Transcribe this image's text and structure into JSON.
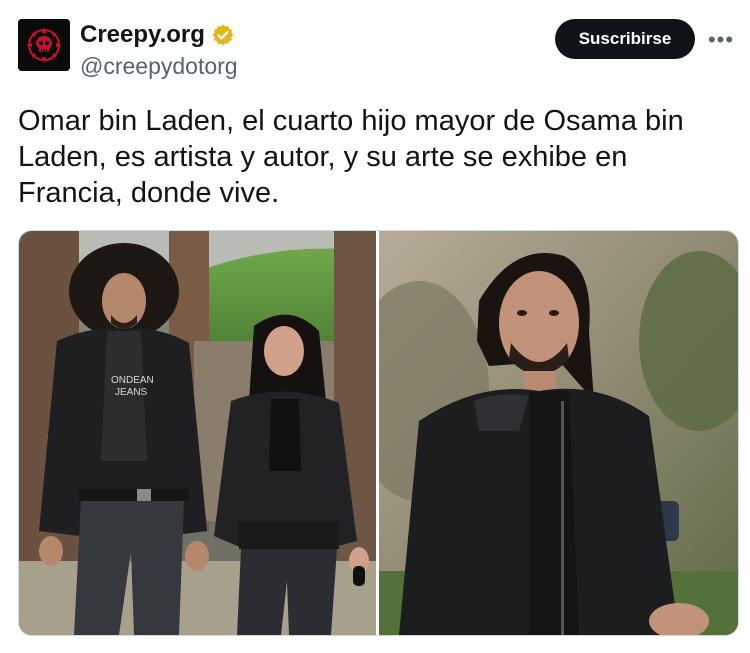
{
  "tweet": {
    "display_name": "Creepy.org",
    "handle": "@creepydotorg",
    "subscribe_label": "Suscribirse",
    "more_label": "•••",
    "text": "Omar bin Laden, el cuarto hijo mayor de Osama bin\nLaden, es artista y autor, y su arte se exhibe en\nFrancia, donde vive.",
    "verified": true,
    "avatar_icon": "skull-logo-icon",
    "media": [
      {
        "name": "photo-couple-walking",
        "shirt_text": "ONDEAN JEANS"
      },
      {
        "name": "photo-man-portrait"
      }
    ]
  },
  "colors": {
    "text": "#0f1419",
    "secondary": "#536471",
    "button_bg": "#0f1419",
    "button_text": "#ffffff",
    "verified_badge": "#e2b719",
    "avatar_accent": "#c8102e"
  }
}
